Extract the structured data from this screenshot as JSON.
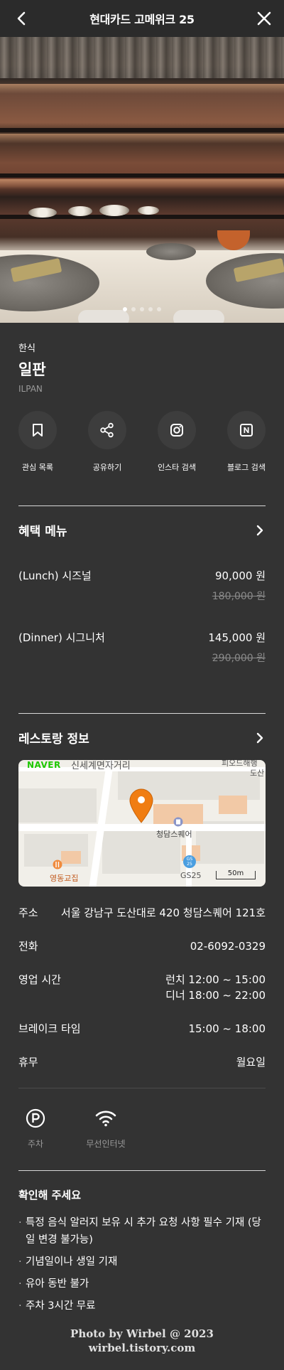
{
  "header": {
    "title": "현대카드 고메위크 25"
  },
  "hero": {
    "slide_count": 5,
    "active_slide": 1
  },
  "restaurant": {
    "category": "한식",
    "name": "일판",
    "name_en": "ILPAN"
  },
  "actions": [
    {
      "label": "관심 목록",
      "icon": "bookmark-icon"
    },
    {
      "label": "공유하기",
      "icon": "share-icon"
    },
    {
      "label": "인스타 검색",
      "icon": "instagram-icon"
    },
    {
      "label": "블로그 검색",
      "icon": "naver-blog-icon"
    }
  ],
  "benefit_menu": {
    "title": "혜택 메뉴",
    "items": [
      {
        "name": "(Lunch)  시즈널",
        "price": "90,000 원",
        "original_price": "180,000 원"
      },
      {
        "name": "(Dinner)  시그니처",
        "price": "145,000 원",
        "original_price": "290,000 원"
      }
    ]
  },
  "restaurant_info": {
    "title": "레스토랑 정보",
    "map": {
      "provider": "NAVER",
      "labels": [
        "신세계면자거리",
        "피오드해행",
        "도산",
        "청담스퀘어",
        "영동교집",
        "GS25"
      ],
      "gs_badge": "GS\n25",
      "scale": "50m",
      "pin_color": "#f07d12"
    },
    "rows": [
      {
        "key": "주소",
        "value": "서울 강남구 도산대로 420 청담스퀘어 121호"
      },
      {
        "key": "전화",
        "value": "02-6092-0329"
      },
      {
        "key": "영업 시간",
        "value_lines": [
          "런치 12:00 ~ 15:00",
          "디너 18:00 ~ 22:00"
        ]
      },
      {
        "key": "브레이크 타임",
        "value": "15:00 ~ 18:00"
      },
      {
        "key": "휴무",
        "value": "월요일"
      }
    ]
  },
  "amenities": [
    {
      "label": "주차",
      "icon": "parking-icon"
    },
    {
      "label": "무선인터넷",
      "icon": "wifi-icon"
    }
  ],
  "notice": {
    "title": "확인해 주세요",
    "items": [
      "특정 음식 알러지 보유 시 추가 요청 사항 필수 기재 (당일 변경 불가능)",
      "기념일이나 생일 기재",
      "유아 동반 불가",
      "주차 3시간 무료"
    ]
  },
  "watermark": {
    "line1": "Photo by Wirbel @ 2023",
    "line2": "wirbel.tistory.com"
  },
  "colors": {
    "background": "#333333",
    "header": "#2b2b2b",
    "muted": "#9a9a9a",
    "strike": "#8a8a8a",
    "pin": "#f07d12"
  }
}
